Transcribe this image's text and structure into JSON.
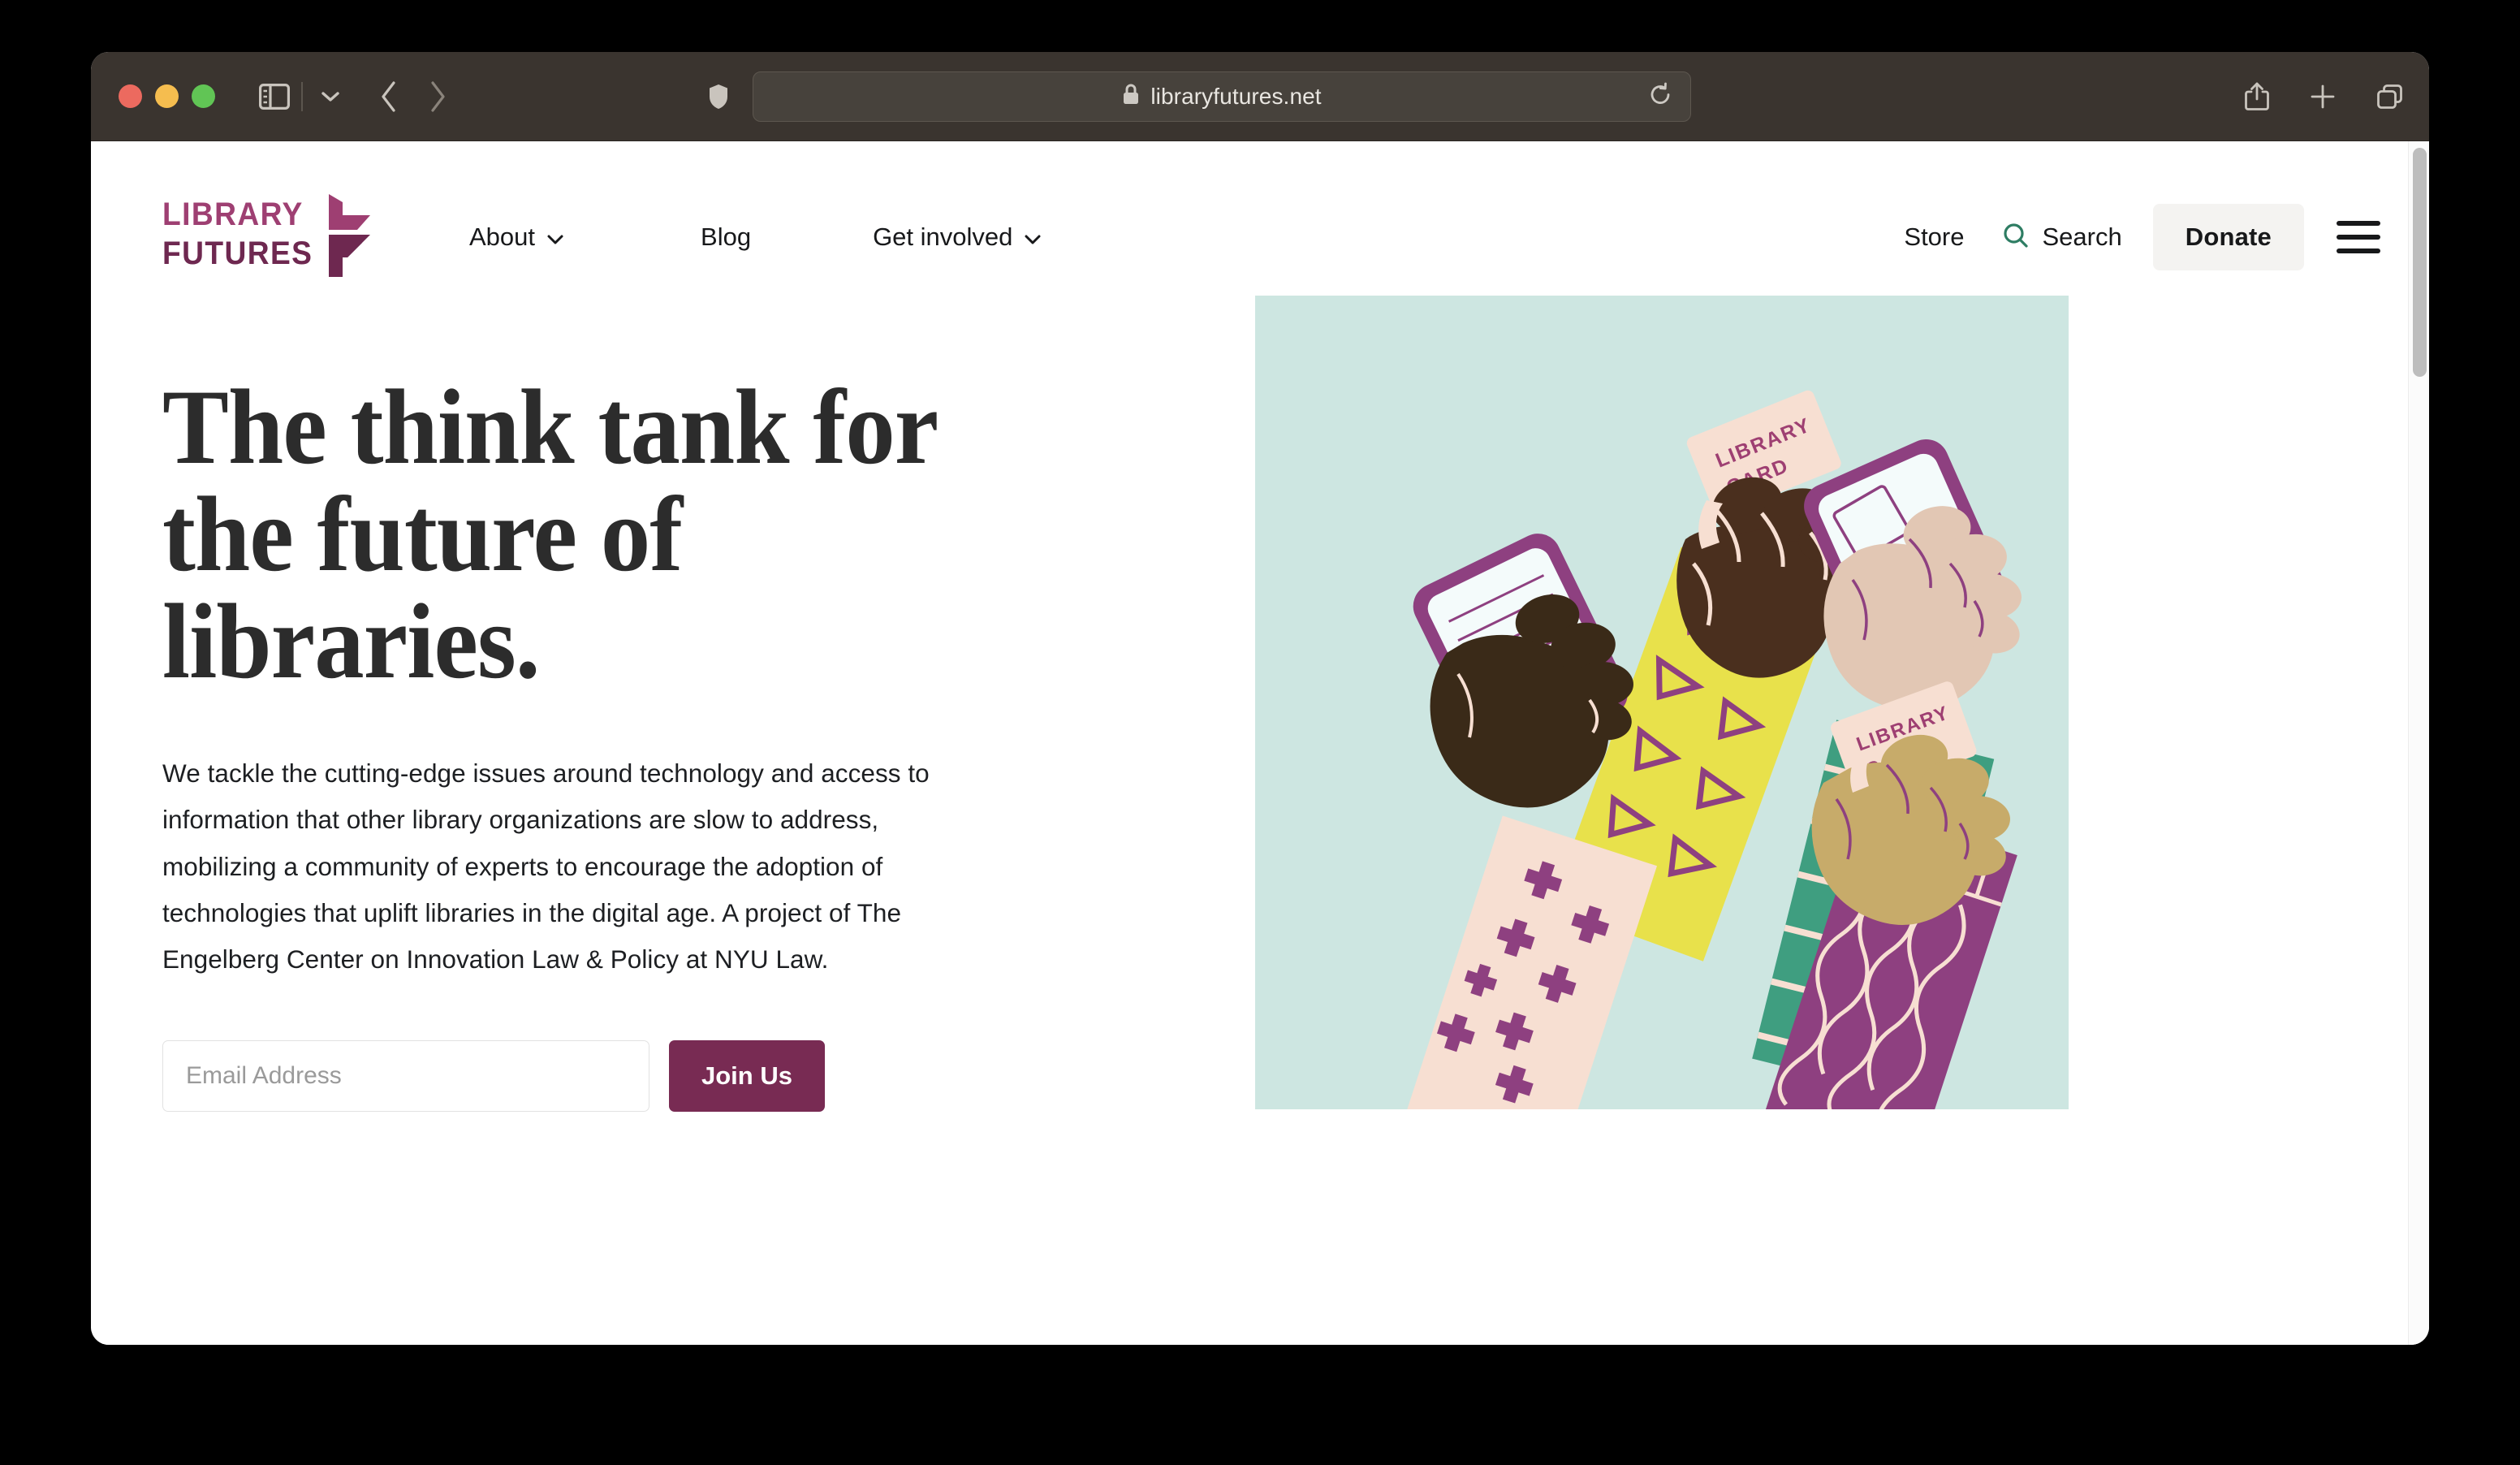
{
  "browser": {
    "url": "libraryfutures.net",
    "lock_icon": "lock-icon",
    "shield_icon": "privacy-shield-icon",
    "reload_icon": "reload-icon",
    "sidebar_icon": "sidebar-toggle-icon",
    "dropdown_icon": "chevron-down-icon",
    "back_icon": "back-arrow-icon",
    "forward_icon": "forward-arrow-icon",
    "share_icon": "share-icon",
    "newtab_icon": "plus-icon",
    "tabs_icon": "tab-overview-icon",
    "traffic_lights": [
      "close",
      "minimize",
      "maximize"
    ]
  },
  "site": {
    "logo": {
      "line1": "LIBRARY",
      "line2": "FUTURES",
      "mark": "bookmark-arrow-mark"
    },
    "nav": [
      {
        "label": "About",
        "has_dropdown": true
      },
      {
        "label": "Blog",
        "has_dropdown": false
      },
      {
        "label": "Get involved",
        "has_dropdown": true
      }
    ],
    "store_label": "Store",
    "search_label": "Search",
    "search_icon": "search-icon",
    "donate_label": "Donate",
    "menu_icon": "hamburger-menu-icon"
  },
  "hero": {
    "headline": "The think tank for\nthe future of\nlibraries.",
    "body": "We tackle the cutting-edge issues around technology and access to information that other library organizations are slow to address, mobilizing a community of experts to encourage the adoption of technologies that uplift libraries in the digital age. A project of The Engelberg Center on Innovation Law & Policy at NYU Law.",
    "email_placeholder": "Email Address",
    "email_value": "",
    "join_label": "Join Us",
    "illustration": {
      "alt": "Four raised fists holding library cards and e-readers",
      "card_text_line1": "LIBRARY",
      "card_text_line2": "CARD",
      "background": "#cde6e1"
    }
  },
  "colors": {
    "brand_plum": "#782b53",
    "brand_magenta": "#9e3f72",
    "search_green": "#2e7d63",
    "mint": "#cde6e1",
    "yellow": "#e8e14b",
    "teal": "#3f9e80",
    "cream": "#f6ded0",
    "skin_dark": "#4a2f1e",
    "skin_darkest": "#3a2a18",
    "skin_tan": "#c7ab6a",
    "skin_light": "#e2c7b4"
  }
}
